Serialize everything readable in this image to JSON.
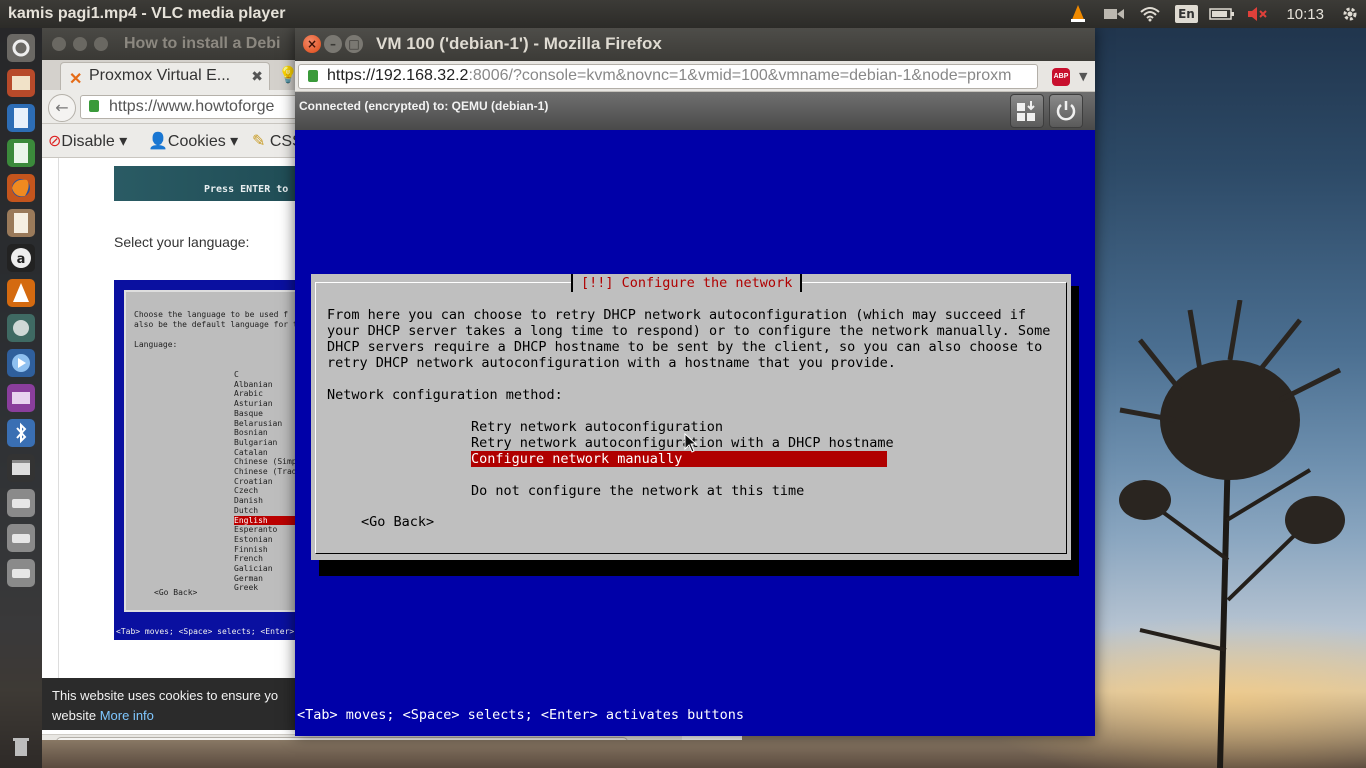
{
  "top_panel": {
    "title": "kamis pagi1.mp4 - VLC media player",
    "keyboard_layout": "En",
    "clock": "10:13"
  },
  "launcher": {
    "items": [
      "dash-icon",
      "files-icon",
      "document-icon",
      "spreadsheet-icon",
      "firefox-icon",
      "text-editor-icon",
      "amazon-icon",
      "vlc-icon",
      "disk-icon",
      "media-player-icon",
      "screenshot-icon",
      "bluetooth-icon",
      "video-editor-icon",
      "drive-icon",
      "drive-icon",
      "drive-icon",
      "trash-icon"
    ]
  },
  "bg_browser": {
    "title": "How to install a Debi",
    "tab_label": "Proxmox Virtual E...",
    "url": "https://www.howtoforge",
    "toolbar": {
      "disable": "Disable",
      "cookies": "Cookies",
      "css": "CSS"
    },
    "page": {
      "banner_text": "Press ENTER to",
      "select_language": "Select your language:",
      "shot_intro_1": "Choose the language to be used f",
      "shot_intro_2": "also be the default language for t",
      "shot_language_label": "Language:",
      "languages": [
        "C",
        "Albanian",
        "Arabic",
        "Asturian",
        "Basque",
        "Belarusian",
        "Bosnian",
        "Bulgarian",
        "Catalan",
        "Chinese (Simp",
        "Chinese (Trad",
        "Croatian",
        "Czech",
        "Danish",
        "Dutch",
        "English",
        "Esperanto",
        "Estonian",
        "Finnish",
        "French",
        "Galician",
        "German",
        "Greek"
      ],
      "selected_language": "English",
      "shot_go_back": "<Go Back>",
      "shot_footer": "<Tab> moves; <Space> selects; <Enter>"
    },
    "cookie_bar": {
      "line1": "This website uses cookies to ensure yo",
      "line2_prefix": "website",
      "more_info": "More info"
    }
  },
  "firefox": {
    "title": "VM 100 ('debian-1') - Mozilla Firefox",
    "url_host": "https://192.168.32.2",
    "url_rest": ":8006/?console=kvm&novnc=1&vmid=100&vmname=debian-1&node=proxm",
    "novnc_status": "Connected (encrypted) to: QEMU (debian-1)"
  },
  "installer": {
    "dialog_title": "[!!] Configure the network",
    "description": [
      "From here you can choose to retry DHCP network autoconfiguration (which may succeed if",
      "your DHCP server takes a long time to respond) or to configure the network manually. Some",
      "DHCP servers require a DHCP hostname to be sent by the client, so you can also choose to",
      "retry DHCP network autoconfiguration with a hostname that you provide."
    ],
    "method_label": "Network configuration method:",
    "options": [
      "Retry network autoconfiguration",
      "Retry network autoconfiguration with a DHCP hostname",
      "Configure network manually",
      "Do not configure the network at this time"
    ],
    "selected_option": "Configure network manually",
    "go_back": "<Go Back>",
    "footer": "<Tab> moves; <Space> selects; <Enter> activates buttons"
  }
}
